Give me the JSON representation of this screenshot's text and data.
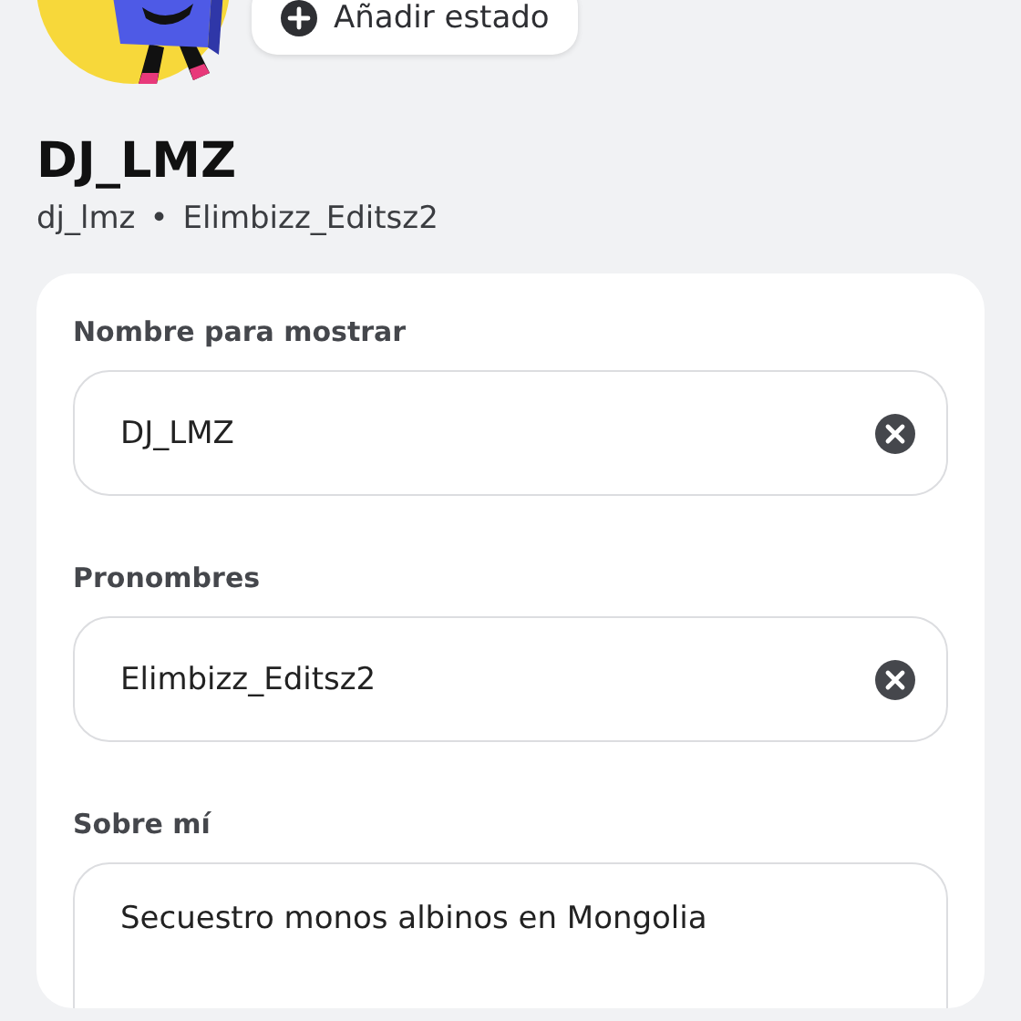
{
  "status_button": {
    "label": "Añadir estado"
  },
  "profile": {
    "display_name": "DJ_LMZ",
    "username": "dj_lmz",
    "separator": "•",
    "pronouns": "Elimbizz_Editsz2"
  },
  "form": {
    "fields": [
      {
        "label": "Nombre para mostrar",
        "kind": "text",
        "value": "DJ_LMZ",
        "clearable": true
      },
      {
        "label": "Pronombres",
        "kind": "text",
        "value": "Elimbizz_Editsz2",
        "clearable": true
      },
      {
        "label": "Sobre mí",
        "kind": "multiline",
        "value": "Secuestro monos albinos en Mongolia",
        "clearable": false
      }
    ]
  }
}
